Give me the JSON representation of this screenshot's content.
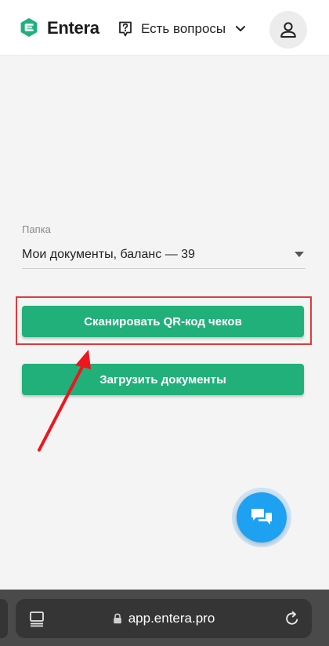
{
  "header": {
    "brand": "Entera",
    "help_label": "Есть вопросы",
    "icons": {
      "logo": "entera-logo-icon",
      "help": "question-icon",
      "dropdown": "chevron-down-icon",
      "account": "user-icon"
    }
  },
  "folder": {
    "label": "Папка",
    "value": "Мои документы, баланс — 39"
  },
  "actions": {
    "scan_label": "Сканировать QR-код чеков",
    "upload_label": "Загрузить документы"
  },
  "chat": {
    "icon": "chat-icon"
  },
  "browser": {
    "url": "app.entera.pro"
  },
  "colors": {
    "accent": "#21b07a",
    "highlight": "#e03a3a",
    "chat": "#1ea1f1",
    "background": "#f4f4f4"
  }
}
